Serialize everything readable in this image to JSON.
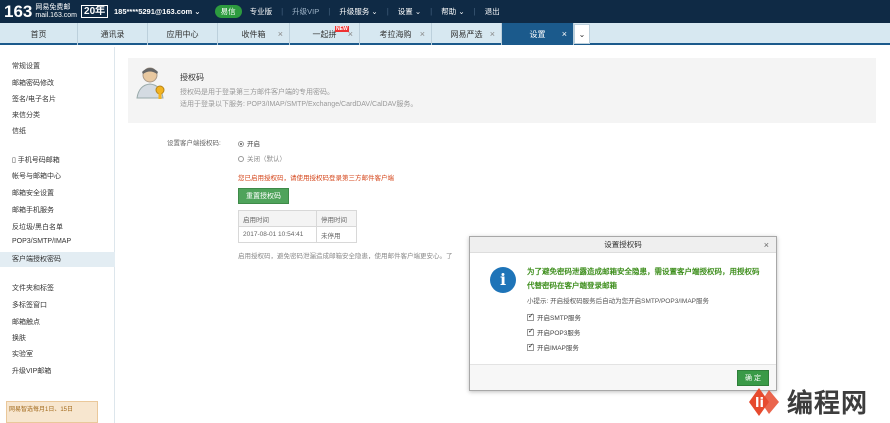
{
  "topbar": {
    "logo_num": "163",
    "logo_brand_line1": "网易免费邮",
    "logo_brand_line2": "mail.163.com",
    "logo_years": "20年",
    "email": "185****5291@163.com ⌄",
    "yixin": "易信",
    "pro": "专业版",
    "upgrade": "升级VIP",
    "upgrade_service": "升级服务 ⌄",
    "settings": "设置 ⌄",
    "help": "帮助 ⌄",
    "logout": "退出"
  },
  "tabs": [
    {
      "label": "首页"
    },
    {
      "label": "通讯录"
    },
    {
      "label": "应用中心"
    },
    {
      "label": "收件箱",
      "close": "×"
    },
    {
      "label": "一起拼",
      "close": "×",
      "badge": "NEW"
    },
    {
      "label": "考拉海购",
      "close": "×"
    },
    {
      "label": "网易严选",
      "close": "×"
    },
    {
      "label": "设置",
      "close": "×"
    },
    {
      "label": "⌄"
    }
  ],
  "sidebar": {
    "items": [
      "常规设置",
      "邮箱密码修改",
      "签名/电子名片",
      "来信分类",
      "信纸",
      "▯ 手机号码邮箱",
      "帐号与邮箱中心",
      "邮箱安全设置",
      "邮箱手机服务",
      "反垃圾/黑白名单",
      "POP3/SMTP/IMAP",
      "客户端授权密码",
      "文件夹和标签",
      "多标签窗口",
      "邮箱触点",
      "换肤",
      "实验室",
      "升级VIP邮箱"
    ],
    "promo": "网易智选每月1日、15日"
  },
  "main": {
    "title": "授权码",
    "desc1": "授权码是用于登录第三方邮件客户端的专用密码。",
    "desc2": "适用于登录以下服务: POP3/IMAP/SMTP/Exchange/CardDAV/CalDAV服务。",
    "setting_label": "设置客户端授权码:",
    "opt_on": "开启",
    "opt_off": "关闭（默认）",
    "notice": "您已启用授权码，请使用授权码登录第三方邮件客户端",
    "reset_btn": "重置授权码",
    "table_headers": [
      "启用时间",
      "停用时间"
    ],
    "table_row": [
      "2017-08-01 10:54:41",
      "未停用"
    ],
    "footnote": "启用授权码，避免密码泄漏造成邮箱安全隐患，使用邮件客户端更安心。了"
  },
  "dialog": {
    "title": "设置授权码",
    "close": "×",
    "message": "为了避免密码泄露造成邮箱安全隐患，需设置客户端授权码，用授权码代替密码在客户端登录邮箱",
    "tip": "小提示: 开启授权码服务后自动为您开启SMTP/POP3/IMAP服务",
    "options": [
      {
        "label": "开启SMTP服务",
        "checked": true
      },
      {
        "label": "开启POP3服务",
        "checked": true
      },
      {
        "label": "开启IMAP服务",
        "checked": true
      }
    ],
    "ok": "确 定"
  },
  "watermark": {
    "text": "编程网"
  }
}
